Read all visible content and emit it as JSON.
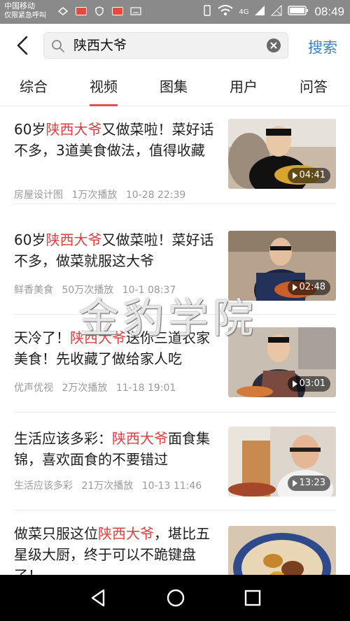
{
  "status_bar": {
    "carrier": "中国移动",
    "carrier_sub": "仅限紧急呼叫",
    "network": "4G",
    "time": "08:49"
  },
  "search": {
    "query": "陕西大爷",
    "button_label": "搜索"
  },
  "tabs": [
    {
      "label": "综合",
      "active": false
    },
    {
      "label": "视频",
      "active": true
    },
    {
      "label": "图集",
      "active": false
    },
    {
      "label": "用户",
      "active": false
    },
    {
      "label": "问答",
      "active": false
    }
  ],
  "results": [
    {
      "title_before": "60岁",
      "highlight": "陕西大爷",
      "title_after": "又做菜啦！菜好话不多，3道美食做法，值得收藏",
      "source": "房屋设计图",
      "plays": "1万次播放",
      "date": "10-28 22:39",
      "duration": "04:41"
    },
    {
      "title_before": "60岁",
      "highlight": "陕西大爷",
      "title_after": "又做菜啦！菜好话不多，做菜就服这大爷",
      "source": "鲜香美食",
      "plays": "50万次播放",
      "date": "10-1 08:37",
      "duration": "02:48"
    },
    {
      "title_before": "天冷了！",
      "highlight": "陕西大爷",
      "title_after": "送你三道农家美食！先收藏了做给家人吃",
      "source": "优声优视",
      "plays": "2万次播放",
      "date": "11-18 19:01",
      "duration": "03:01"
    },
    {
      "title_before": "生活应该多彩：",
      "highlight": "陕西大爷",
      "title_after": "面食集锦，喜欢面食的不要错过",
      "source": "生活应该多彩",
      "plays": "21万次播放",
      "date": "10-13 11:46",
      "duration": "13:23"
    },
    {
      "title_before": "做菜只服这位",
      "highlight": "陕西大爷",
      "title_after": "，堪比五星级大厨，终于可以不跪键盘了！",
      "source": "",
      "plays": "",
      "date": "",
      "duration": ""
    }
  ],
  "watermark": "金豹学院",
  "colors": {
    "highlight": "#e23e3e",
    "accent": "#3b82c4",
    "tab_indicator": "#d9534f"
  }
}
